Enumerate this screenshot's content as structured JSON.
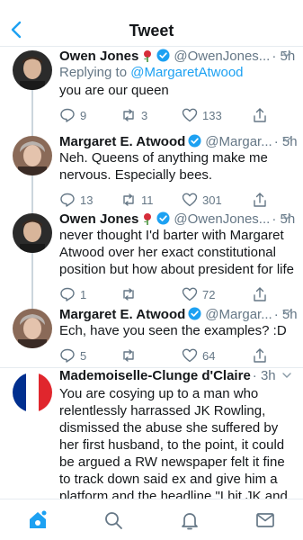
{
  "header": {
    "title": "Tweet"
  },
  "tweets": [
    {
      "name": "Owen Jones",
      "has_rose": true,
      "verified": true,
      "handle": "@OwenJones...",
      "time": "· 5h",
      "reply_prefix": "Replying to",
      "reply_to": "@MargaretAtwood",
      "text": "you are our queen",
      "replies": "9",
      "retweets": "3",
      "likes": "133"
    },
    {
      "name": "Margaret E. Atwood",
      "verified": true,
      "handle": "@Margar...",
      "time": "· 5h",
      "text": "Neh. Queens of anything make me nervous. Especially bees.",
      "replies": "13",
      "retweets": "11",
      "likes": "301"
    },
    {
      "name": "Owen Jones",
      "has_rose": true,
      "verified": true,
      "handle": "@OwenJones...",
      "time": "· 5h",
      "text": "never thought I'd barter with Margaret Atwood over her exact constitutional position but how about president for life",
      "replies": "1",
      "retweets": "",
      "likes": "72"
    },
    {
      "name": "Margaret E. Atwood",
      "verified": true,
      "handle": "@Margar...",
      "time": "· 5h",
      "text": "Ech, have you seen the examples?  :D",
      "replies": "5",
      "retweets": "",
      "likes": "64"
    },
    {
      "name": "Mademoiselle-Clunge d'Claire",
      "time": "· 3h",
      "text": "You are cosying up to a man who relentlessly harrassed JK Rowling, dismissed the abuse she suffered by her first husband, to the point, it could be argued a RW newspaper felt it fine to track down said ex and give him a platform and the headline \"I hit JK and I'm not sorry\""
    }
  ],
  "colors": {
    "accent": "#1da1f2",
    "text": "#14171a",
    "secondary": "#657786",
    "border": "#e6ecf0",
    "thread_line": "#ccd6dd"
  },
  "icons": {
    "back": "chevron-left-icon",
    "reply": "reply-icon",
    "retweet": "retweet-icon",
    "like": "heart-icon",
    "share": "share-icon",
    "home": "home-icon",
    "search": "search-icon",
    "notifications": "bell-icon",
    "messages": "envelope-icon"
  }
}
